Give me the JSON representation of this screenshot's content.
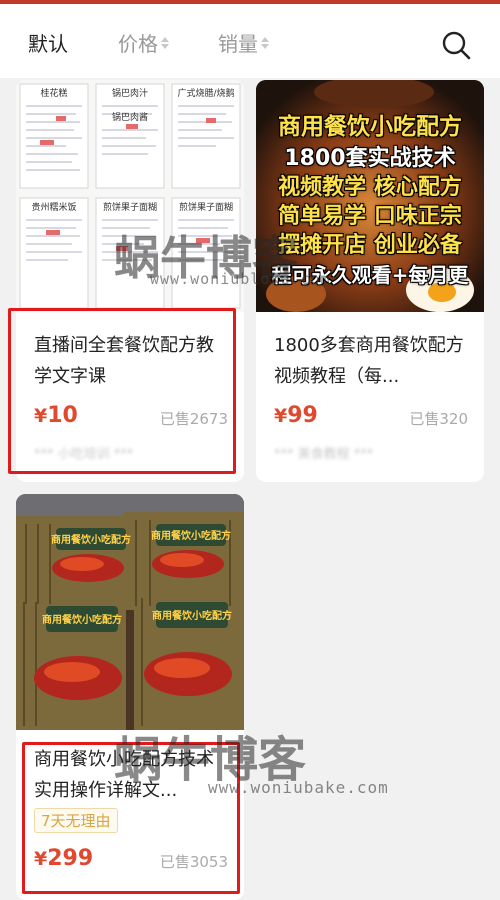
{
  "sort_tabs": {
    "default": "默认",
    "price": "价格",
    "sales": "销量"
  },
  "products": [
    {
      "title": "直播间全套餐饮配方教学文字课",
      "currency": "¥",
      "price": "10",
      "sold": "已售2673",
      "shop": "*** 小吃培训 ***",
      "thumb_notes": [
        "桂花糕",
        "锅巴肉汁",
        "广式烧腊/烧鹅",
        "锅巴肉酱",
        "贵州糯米饭",
        "煎饼果子面糊",
        "煎饼果子面糊"
      ]
    },
    {
      "title": "1800多套商用餐饮配方视频教程（每...",
      "currency": "¥",
      "price": "99",
      "sold": "已售320",
      "shop": "*** 美食教程 ***",
      "poster_lines": [
        "商用餐饮小吃配方",
        "1800套实战技术",
        "视频教学 核心配方",
        "简单易学 口味正宗",
        "摆摊开店 创业必备",
        "程可永久观看+每月更"
      ]
    },
    {
      "title": "商用餐饮小吃配方技术实用操作详解文...",
      "tag": "7天无理由",
      "currency": "¥",
      "price": "299",
      "sold": "已售3053",
      "book_title": "商用餐饮小吃配方"
    }
  ],
  "watermark": {
    "brand": "蜗牛博客",
    "url": "www.woniubloke.com",
    "url2": "www.woniubake.com"
  },
  "colors": {
    "accent": "#e0492f",
    "highlight_box": "#e21a1a",
    "tag_text": "#d9a441"
  }
}
